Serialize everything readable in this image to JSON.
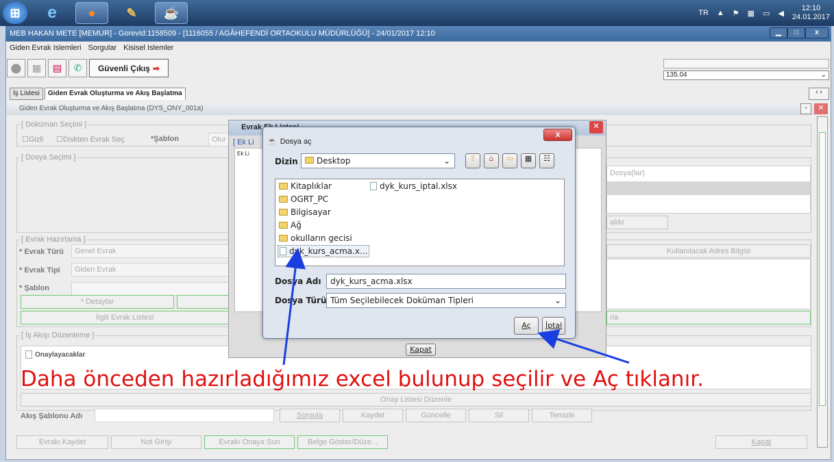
{
  "taskbar": {
    "lang": "TR",
    "time": "12:10",
    "date": "24.01.2017"
  },
  "window": {
    "title": "MEB  HAKAN METE [MEMUR] - GorevId:1158509 - [1116055 / AGÂHEFENDİ ORTAOKULU MÜDÜRLÜĞÜ] - 24/01/2017 12:10"
  },
  "menu": [
    "Giden Evrak Islemleri",
    "Sorgular",
    "Kisisel Islemler"
  ],
  "toolbar": {
    "exit_label": "Güvenli Çıkış"
  },
  "version": "135.04",
  "tabs": [
    "İş Listesi",
    "Giden Evrak Oluşturma ve Akış Başlatma"
  ],
  "form_title": "Giden Evrak Oluşturma ve Akış Başlatma (DYS_ONY_001a)",
  "groups": {
    "dokuman": "[ Doküman Seçimi ]",
    "dosya": "[ Dosya Seçimi ]",
    "evrak": "[ Evrak Hazırlama ]",
    "akis": "[ İş Akışı Düzenleme ]"
  },
  "doc_select": {
    "gizli": "Gizli",
    "disk": "Diskten Evrak Seç",
    "sablon": "*Şablon",
    "olur": "Olur"
  },
  "evrak": {
    "turu_label": "* Evrak Türü",
    "turu": "Genel Evrak",
    "tipi_label": "* Evrak Tipi",
    "tipi": "Giden Evrak",
    "sablon": "* Şablon",
    "detaylar": "* Detaylar",
    "ilgili": "İlgili Evrak Listesi",
    "adres": "Kullanılacak Adres Bilgisi",
    "dosyalar": "Dosya(lar)",
    "kaldir": "aldır",
    "ekle": "rla"
  },
  "akis": {
    "onay": "Onaylayacaklar",
    "duzenle": "Onay Listesi Düzenle",
    "sablon_adi": "Akış Şablonu Adı",
    "sorgula": "Sorgula",
    "kaydet": "Kaydet",
    "guncelle": "Güncelle",
    "sil": "Sil",
    "temizle": "Temizle"
  },
  "bottom": {
    "kaydet": "Evrakı Kaydet",
    "not": "Not Girişi",
    "onaya": "Evrakı Onaya Sun",
    "belge": "Belge Göster/Düze...",
    "kapat": "Kapat"
  },
  "bg_dialog": {
    "title": "Evrak Ek Listesi",
    "tab": "[ Ek Li",
    "inner": "Ek Li",
    "kapat": "Kapat"
  },
  "file_dialog": {
    "title": "Dosya aç",
    "dizin_label": "Dizin",
    "dizin_value": "Desktop",
    "items_left": [
      "Kitaplıklar",
      "OGRT_PC",
      "Bilgisayar",
      "Ağ",
      "okulların gecisi"
    ],
    "selected_item": "dyk_kurs_acma.x...",
    "items_right": [
      "dyk_kurs_iptal.xlsx"
    ],
    "dosya_adi_label": "Dosya Adı",
    "dosya_adi": "dyk_kurs_acma.xlsx",
    "dosya_turu_label": "Dosya Türü",
    "dosya_turu": "Tüm Seçilebilecek Doküman Tipleri",
    "ac": "Aç",
    "iptal": "İptal"
  },
  "annotation": "Daha önceden hazırladığımız excel bulunup seçilir ve Aç tıklanır.",
  "colors": {
    "annotation": "#e01010",
    "arrow": "#1a3ee0"
  }
}
